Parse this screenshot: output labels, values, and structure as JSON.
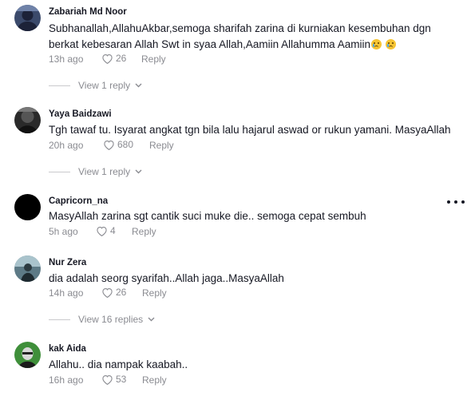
{
  "comments": [
    {
      "username": "Zabariah Md Noor",
      "text": "Subhanallah,AllahuAkbar,semoga sharifah zarina di kurniakan kesembuhan dgn berkat kebesaran Allah Swt in syaa Allah,Aamiin Allahumma Aamiin",
      "emojis": [
        "crying-face-emoji",
        "crying-face-emoji"
      ],
      "time": "13h ago",
      "likes": "26",
      "reply_label": "Reply",
      "view_replies": "View 1 reply",
      "avatar_icon": "profile-avatar"
    },
    {
      "username": "Yaya Baidzawi",
      "text": "Tgh tawaf tu. Isyarat angkat tgn bila lalu hajarul aswad or rukun yamani. MasyaAllah",
      "time": "20h ago",
      "likes": "680",
      "reply_label": "Reply",
      "view_replies": "View 1 reply",
      "avatar_icon": "profile-avatar"
    },
    {
      "username": "Capricorn_na",
      "text": "MasyAllah zarina sgt cantik suci muke die.. semoga cepat sembuh",
      "time": "5h ago",
      "likes": "4",
      "reply_label": "Reply",
      "avatar_icon": "profile-avatar",
      "more_icon": "more-horizontal-icon"
    },
    {
      "username": "Nur Zera",
      "text": "dia adalah seorg syarifah..Allah jaga..MasyaAllah",
      "time": "14h ago",
      "likes": "26",
      "reply_label": "Reply",
      "view_replies": "View 16 replies",
      "avatar_icon": "profile-avatar"
    },
    {
      "username": "kak Aida",
      "text": "Allahu.. dia nampak kaabah..",
      "time": "16h ago",
      "likes": "53",
      "reply_label": "Reply",
      "avatar_icon": "profile-avatar"
    }
  ],
  "colors": {
    "text": "#161823",
    "muted": "#8a8b91",
    "divider": "#c9cacd"
  }
}
